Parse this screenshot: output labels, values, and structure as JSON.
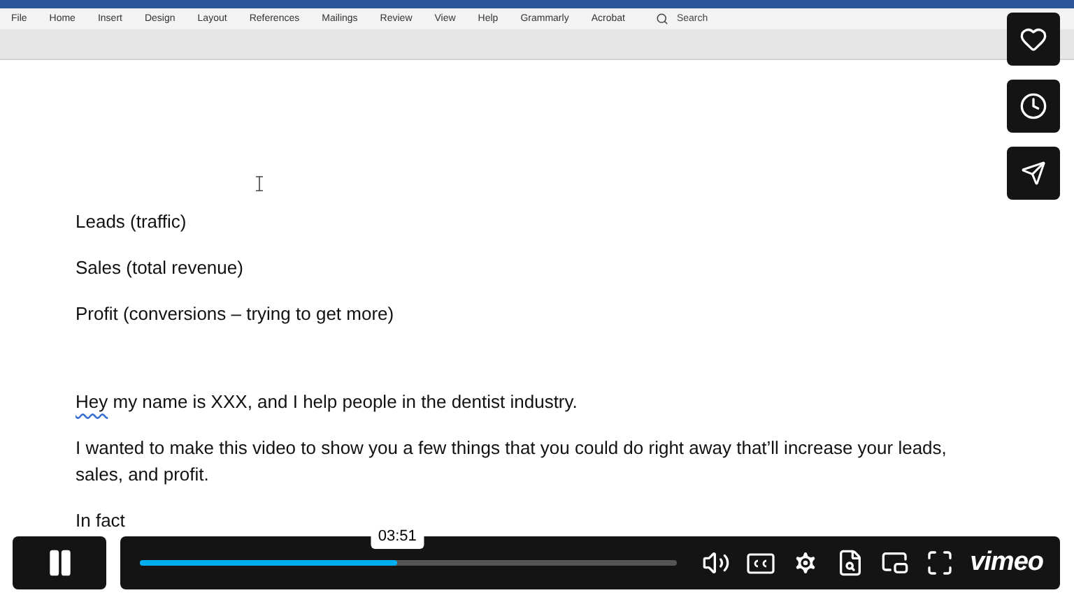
{
  "ribbon": {
    "tabs": [
      {
        "label": "File"
      },
      {
        "label": "Home"
      },
      {
        "label": "Insert"
      },
      {
        "label": "Design"
      },
      {
        "label": "Layout"
      },
      {
        "label": "References"
      },
      {
        "label": "Mailings"
      },
      {
        "label": "Review"
      },
      {
        "label": "View"
      },
      {
        "label": "Help"
      },
      {
        "label": "Grammarly"
      },
      {
        "label": "Acrobat"
      }
    ],
    "search": {
      "placeholder": "Search"
    }
  },
  "document": {
    "paragraphs": [
      {
        "kind": "line",
        "text": "Leads (traffic)"
      },
      {
        "kind": "line",
        "text": "Sales (total revenue)"
      },
      {
        "kind": "line",
        "text": "Profit (conversions – trying to get more)"
      },
      {
        "kind": "blank"
      },
      {
        "kind": "flagged",
        "flagged_word": "Hey",
        "text": " my name is XXX, and I help people in the dentist industry."
      },
      {
        "kind": "line",
        "text": "I wanted to make this video to show you a few things that you could do right away that’ll increase your leads, sales, and profit."
      },
      {
        "kind": "line",
        "text": "In fact"
      }
    ]
  },
  "player": {
    "paused": false,
    "progress": {
      "level": 0.48
    },
    "time_tooltip": "03:51",
    "logo": "vimeo"
  }
}
